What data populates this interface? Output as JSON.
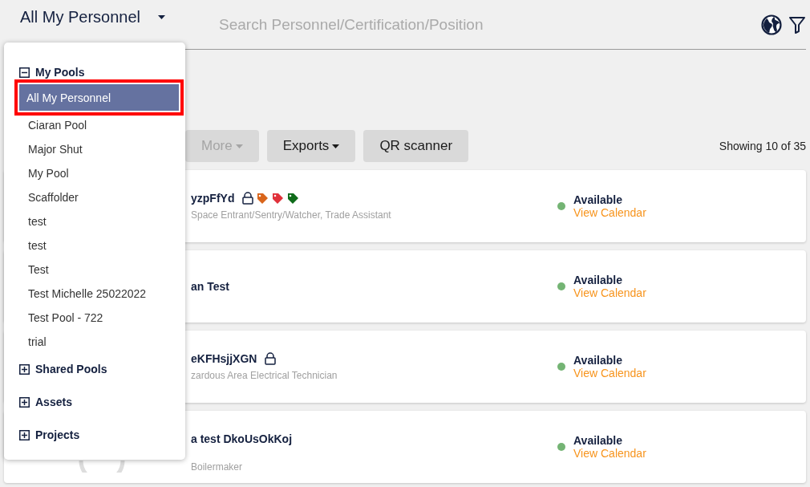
{
  "header": {
    "pool_selector": "All My Personnel",
    "search": {
      "placeholder": "Search Personnel/Certification/Position"
    }
  },
  "toolbar": {
    "buttons": [
      {
        "label": "More",
        "disabled": true,
        "menu": true
      },
      {
        "label": "Exports",
        "disabled": false,
        "menu": true
      },
      {
        "label": "QR scanner",
        "disabled": false,
        "menu": false
      }
    ],
    "showing": "Showing 10 of 35"
  },
  "cards": [
    {
      "name": "yzpFfYd",
      "locked": true,
      "tags": [
        {
          "color": "#d9651b"
        },
        {
          "color": "#e0313a"
        },
        {
          "color": "#0f6b1a"
        }
      ],
      "subtitle": "Space Entrant/Sentry/Watcher, Trade Assistant",
      "status": "Available",
      "link": "View Calendar"
    },
    {
      "name": "an Test",
      "locked": false,
      "status": "Available",
      "link": "View Calendar"
    },
    {
      "name": "eKFHsjjXGN",
      "locked": true,
      "subtitle": "zardous Area Electrical Technician",
      "status": "Available",
      "link": "View Calendar"
    },
    {
      "name": "a test DkoUsOkKoj",
      "locked": false,
      "subtitle": "Boilermaker",
      "status": "Available",
      "link": "View Calendar"
    }
  ],
  "dropdown": {
    "groups": [
      {
        "label": "My Pools",
        "expanded": true,
        "items": [
          {
            "label": "All My Personnel",
            "selected": true
          },
          {
            "label": "Ciaran Pool",
            "selected": false
          },
          {
            "label": "Major Shut",
            "selected": false
          },
          {
            "label": "My Pool",
            "selected": false
          },
          {
            "label": "Scaffolder",
            "selected": false
          },
          {
            "label": "test",
            "selected": false
          },
          {
            "label": "test",
            "selected": false
          },
          {
            "label": "Test",
            "selected": false
          },
          {
            "label": "Test Michelle 25022022",
            "selected": false
          },
          {
            "label": "Test Pool - 722",
            "selected": false
          },
          {
            "label": "trial",
            "selected": false
          }
        ]
      },
      {
        "label": "Shared Pools",
        "expanded": false
      },
      {
        "label": "Assets",
        "expanded": false
      },
      {
        "label": "Projects",
        "expanded": false
      }
    ]
  }
}
